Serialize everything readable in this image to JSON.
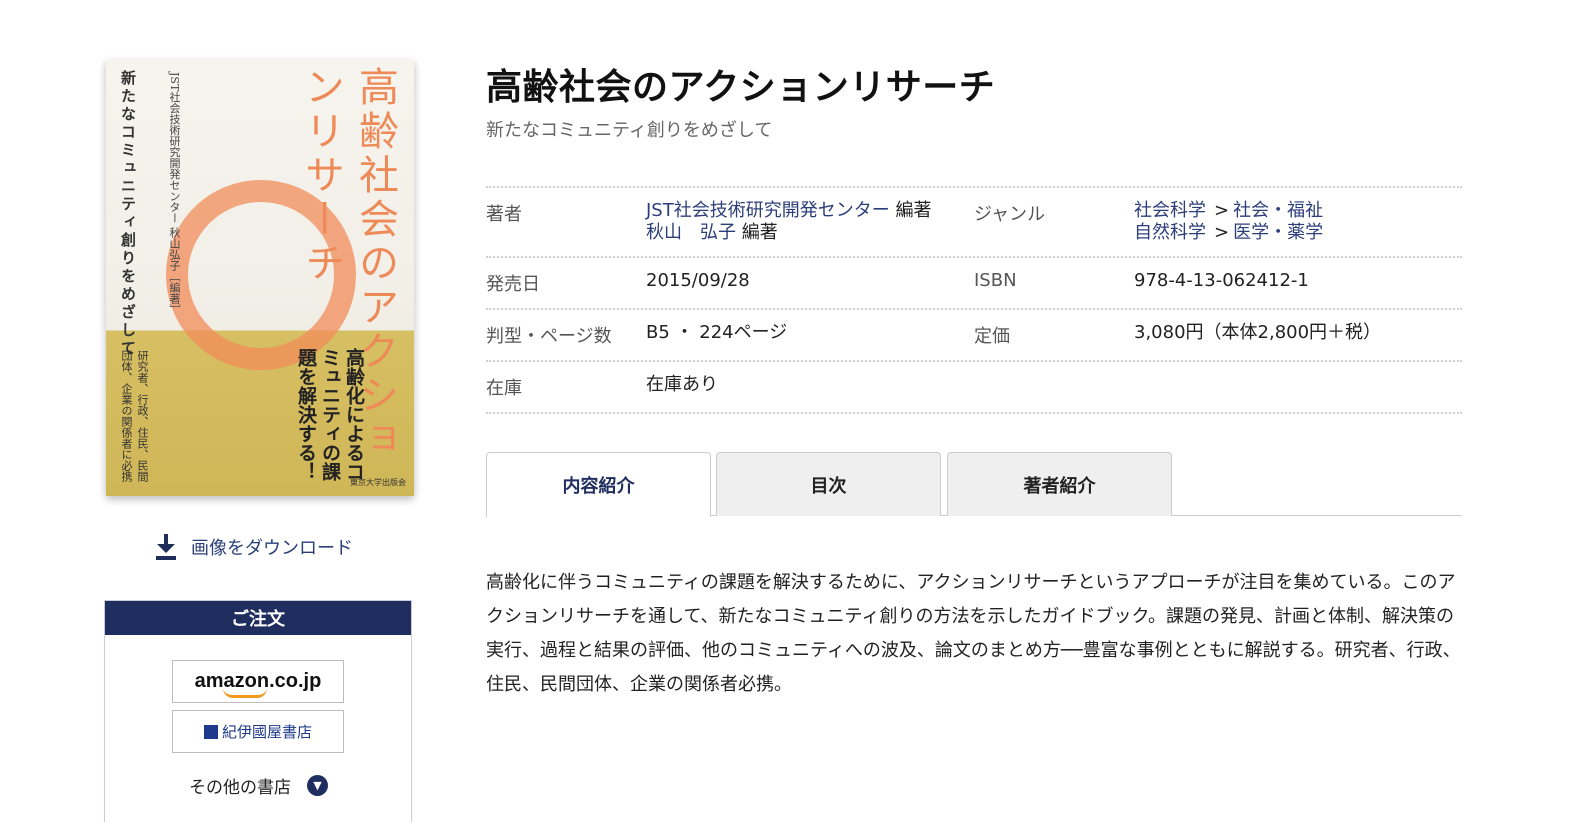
{
  "book": {
    "title": "高齢社会のアクションリサーチ",
    "subtitle": "新たなコミュニティ創りをめざして"
  },
  "cover": {
    "title": "高齢社会のアクションリサーチ",
    "subtitle": "新たなコミュニティ創りをめざして",
    "editors": "JST社会技術研究開発センター 秋山弘子［編著］",
    "catch": "高齢化によるコミュニティの課題を解決する！",
    "features": "研究者、行政、住民、民間団体、企業の関係者に必携",
    "publisher": "東京大学出版会"
  },
  "download": {
    "label": "画像をダウンロード"
  },
  "order": {
    "heading": "ご注文",
    "amazon_label": "amazon.co.jp",
    "kinokuniya_label": "紀伊國屋書店",
    "other_label": "その他の書店"
  },
  "info": {
    "author_label": "著者",
    "authors": [
      {
        "name": "JST社会技術研究開発センター",
        "role": "編著"
      },
      {
        "name": "秋山　弘子",
        "role": "編著"
      }
    ],
    "genre_label": "ジャンル",
    "genres": [
      {
        "main": "社会科学",
        "sub": "社会・福祉"
      },
      {
        "main": "自然科学",
        "sub": "医学・薬学"
      }
    ],
    "release_label": "発売日",
    "release": "2015/09/28",
    "isbn_label": "ISBN",
    "isbn": "978-4-13-062412-1",
    "format_label": "判型・ページ数",
    "format": "B5 ・ 224ページ",
    "price_label": "定価",
    "price": "3,080円（本体2,800円＋税）",
    "stock_label": "在庫",
    "stock": "在庫あり"
  },
  "tabs": [
    {
      "label": "内容紹介",
      "active": true
    },
    {
      "label": "目次",
      "active": false
    },
    {
      "label": "著者紹介",
      "active": false
    }
  ],
  "description": "高齢化に伴うコミュニティの課題を解決するために、アクションリサーチというアプローチが注目を集めている。このアクションリサーチを通して、新たなコミュニティ創りの方法を示したガイドブック。課題の発見、計画と体制、解決策の実行、過程と結果の評価、他のコミュニティへの波及、論文のまとめ方──豊富な事例とともに解説する。研究者、行政、住民、民間団体、企業の関係者必携。"
}
